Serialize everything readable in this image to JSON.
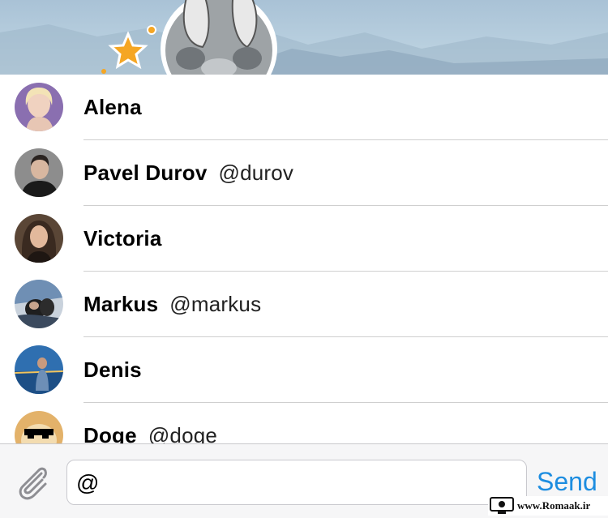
{
  "mentions": [
    {
      "name": "Alena",
      "handle": "",
      "avatar_color": "#8a6fb0"
    },
    {
      "name": "Pavel Durov",
      "handle": "@durov",
      "avatar_color": "#3d3d3d"
    },
    {
      "name": "Victoria",
      "handle": "",
      "avatar_color": "#4a3a30"
    },
    {
      "name": "Markus",
      "handle": "@markus",
      "avatar_color": "#2c3e5c"
    },
    {
      "name": "Denis",
      "handle": "",
      "avatar_color": "#3f7fbf"
    },
    {
      "name": "Doge",
      "handle": "@doge",
      "avatar_color": "#e3b26a"
    }
  ],
  "composer": {
    "value": "@",
    "send_label": "Send",
    "attach_icon": "paperclip-icon"
  },
  "watermark": {
    "text": "www.Romaak.ir"
  },
  "colors": {
    "accent": "#1d8de0",
    "divider": "#cfcfcf",
    "input_bar_bg": "#f6f6f7"
  }
}
